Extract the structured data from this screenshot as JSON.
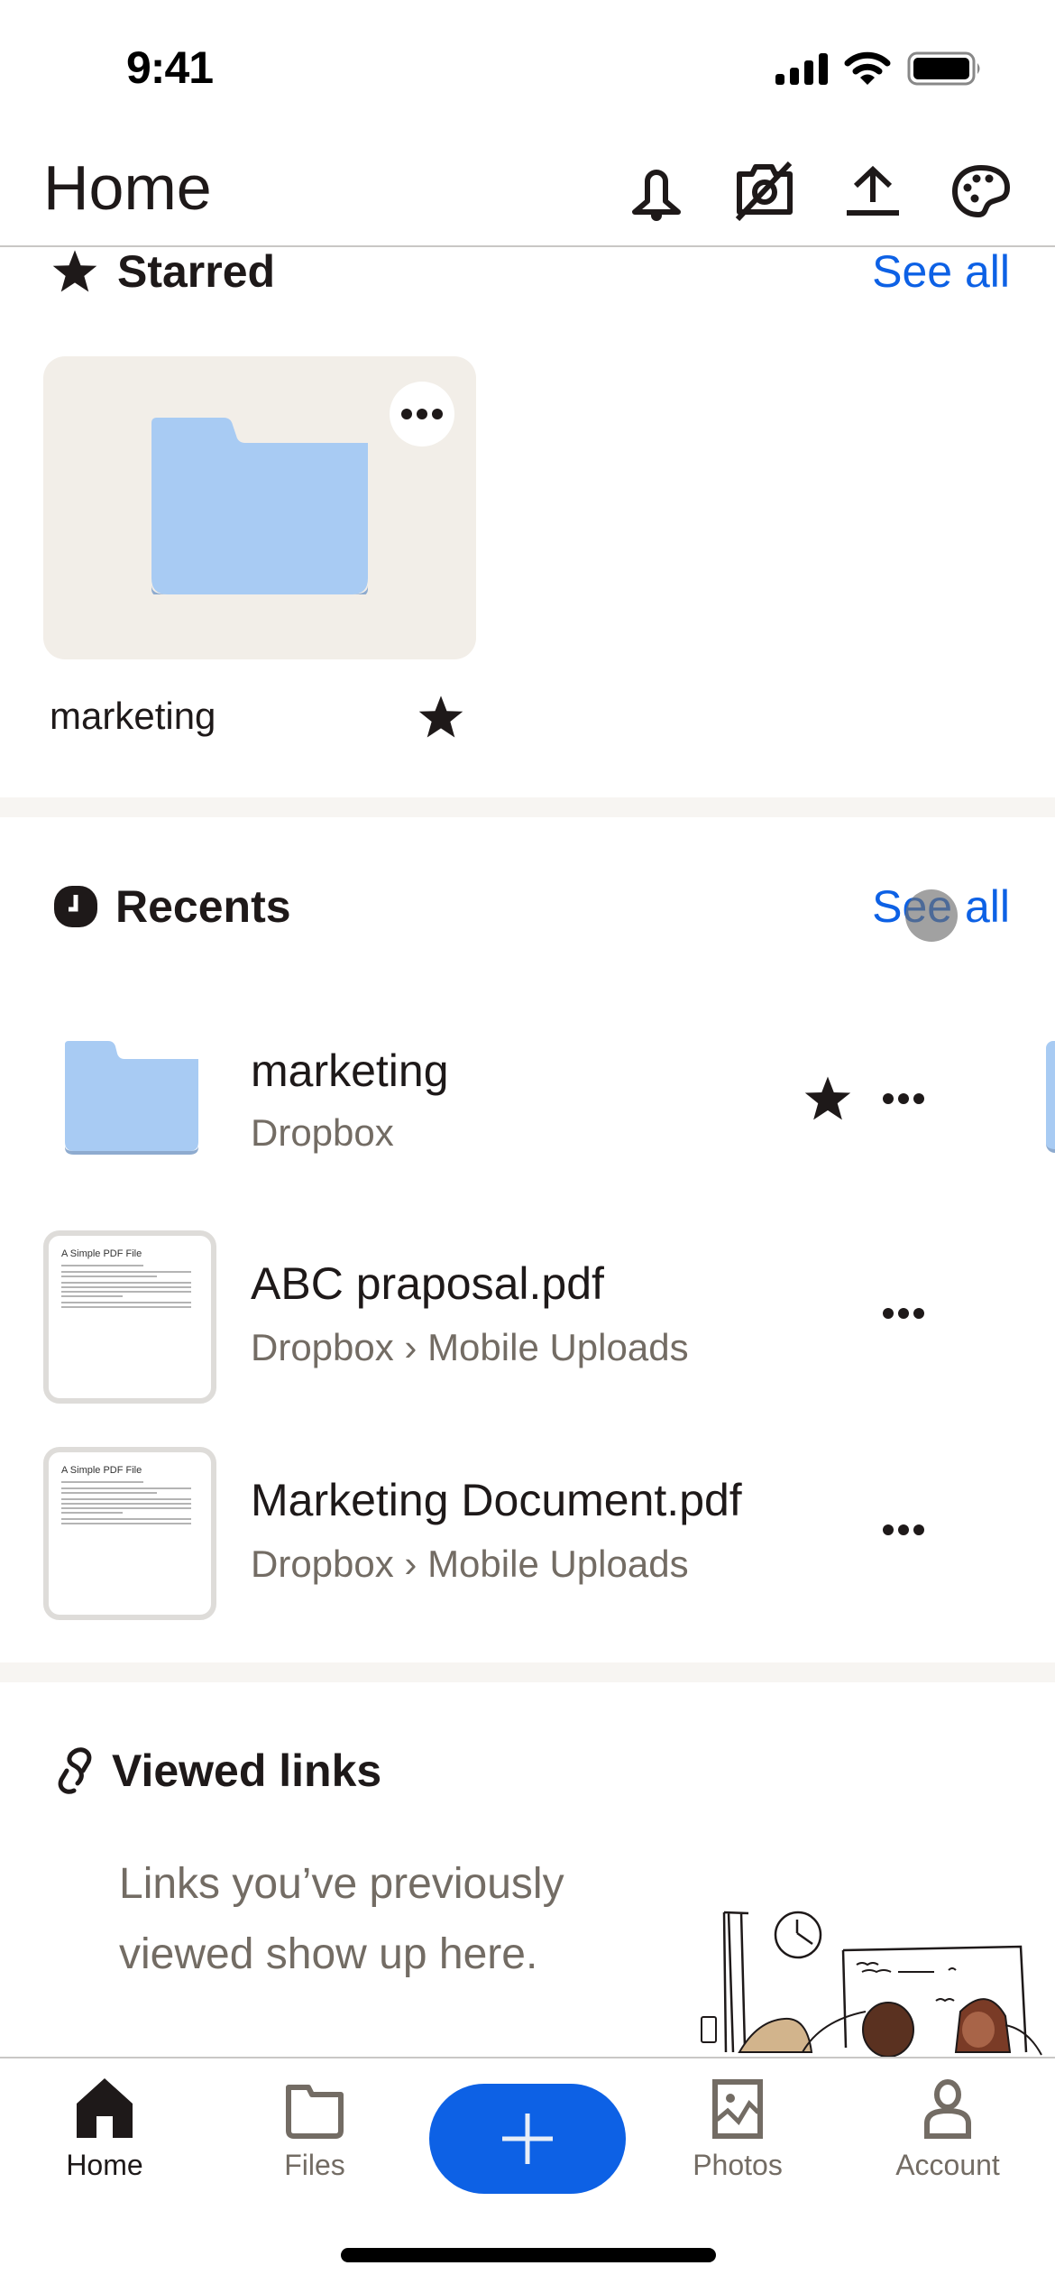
{
  "status_bar": {
    "time": "9:41",
    "icons": [
      "cellular-signal-icon",
      "wifi-icon",
      "battery-icon"
    ]
  },
  "header": {
    "title": "Home",
    "actions": [
      {
        "name": "notifications",
        "icon": "bell-icon"
      },
      {
        "name": "camera-uploads-off",
        "icon": "camera-off-icon"
      },
      {
        "name": "upload",
        "icon": "upload-icon"
      },
      {
        "name": "theme",
        "icon": "palette-icon"
      }
    ]
  },
  "starred": {
    "title": "Starred",
    "icon": "star-icon",
    "see_all": "See all",
    "items": [
      {
        "name": "marketing",
        "type": "folder",
        "starred": true
      }
    ]
  },
  "recents": {
    "title": "Recents",
    "icon": "clock-icon",
    "see_all": "See all",
    "items": [
      {
        "name": "marketing",
        "path": "Dropbox",
        "type": "folder",
        "starred": true
      },
      {
        "name": "ABC praposal.pdf",
        "path": "Dropbox › Mobile Uploads",
        "type": "pdf",
        "starred": false,
        "thumb_title": "A Simple PDF File"
      },
      {
        "name": "Marketing Document.pdf",
        "path": "Dropbox › Mobile Uploads",
        "type": "pdf",
        "starred": false,
        "thumb_title": "A Simple PDF File"
      }
    ]
  },
  "viewed_links": {
    "title": "Viewed links",
    "icon": "link-icon",
    "empty_message": "Links you’ve previously viewed show up here."
  },
  "tab_bar": {
    "tabs": [
      {
        "label": "Home",
        "icon": "home-icon",
        "active": true
      },
      {
        "label": "Files",
        "icon": "folder-icon",
        "active": false
      },
      {
        "label": "Photos",
        "icon": "photos-icon",
        "active": false
      },
      {
        "label": "Account",
        "icon": "account-icon",
        "active": false
      }
    ],
    "fab_icon": "plus-icon"
  },
  "colors": {
    "accent": "#0d61e5",
    "folder": "#a8cbf3",
    "card_bg": "#f2eee8",
    "text_primary": "#1e1919",
    "text_secondary": "#736c64"
  }
}
